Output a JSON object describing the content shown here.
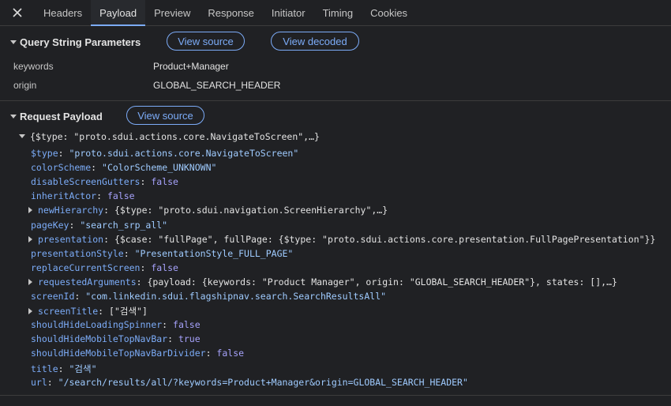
{
  "tabs": {
    "close_icon": "close-icon",
    "items": [
      {
        "label": "Headers"
      },
      {
        "label": "Payload"
      },
      {
        "label": "Preview"
      },
      {
        "label": "Response"
      },
      {
        "label": "Initiator"
      },
      {
        "label": "Timing"
      },
      {
        "label": "Cookies"
      }
    ],
    "active": "Payload"
  },
  "query_string": {
    "title": "Query String Parameters",
    "view_source": "View source",
    "view_decoded": "View decoded",
    "params": [
      {
        "key": "keywords",
        "value": "Product+Manager"
      },
      {
        "key": "origin",
        "value": "GLOBAL_SEARCH_HEADER"
      }
    ]
  },
  "request_payload": {
    "title": "Request Payload",
    "view_source": "View source",
    "root_summary": "{$type: \"proto.sdui.actions.core.NavigateToScreen\",…}",
    "fields": [
      {
        "key": "$type",
        "value": "\"proto.sdui.actions.core.NavigateToScreen\"",
        "kind": "string"
      },
      {
        "key": "colorScheme",
        "value": "\"ColorScheme_UNKNOWN\"",
        "kind": "string"
      },
      {
        "key": "disableScreenGutters",
        "value": "false",
        "kind": "bool"
      },
      {
        "key": "inheritActor",
        "value": "false",
        "kind": "bool"
      },
      {
        "key": "newHierarchy",
        "value": "{$type: \"proto.sdui.navigation.ScreenHierarchy\",…}",
        "kind": "object"
      },
      {
        "key": "pageKey",
        "value": "\"search_srp_all\"",
        "kind": "string"
      },
      {
        "key": "presentation",
        "value": "{$case: \"fullPage\", fullPage: {$type: \"proto.sdui.actions.core.presentation.FullPagePresentation\"}}",
        "kind": "object"
      },
      {
        "key": "presentationStyle",
        "value": "\"PresentationStyle_FULL_PAGE\"",
        "kind": "string"
      },
      {
        "key": "replaceCurrentScreen",
        "value": "false",
        "kind": "bool"
      },
      {
        "key": "requestedArguments",
        "value": "{payload: {keywords: \"Product Manager\", origin: \"GLOBAL_SEARCH_HEADER\"}, states: [],…}",
        "kind": "object"
      },
      {
        "key": "screenId",
        "value": "\"com.linkedin.sdui.flagshipnav.search.SearchResultsAll\"",
        "kind": "string"
      },
      {
        "key": "screenTitle",
        "value": "[\"검색\"]",
        "kind": "object"
      },
      {
        "key": "shouldHideLoadingSpinner",
        "value": "false",
        "kind": "bool"
      },
      {
        "key": "shouldHideMobileTopNavBar",
        "value": "true",
        "kind": "bool"
      },
      {
        "key": "shouldHideMobileTopNavBarDivider",
        "value": "false",
        "kind": "bool"
      },
      {
        "key": "title",
        "value": "\"검색\"",
        "kind": "string"
      },
      {
        "key": "url",
        "value": "\"/search/results/all/?keywords=Product+Manager&origin=GLOBAL_SEARCH_HEADER\"",
        "kind": "string"
      }
    ]
  }
}
